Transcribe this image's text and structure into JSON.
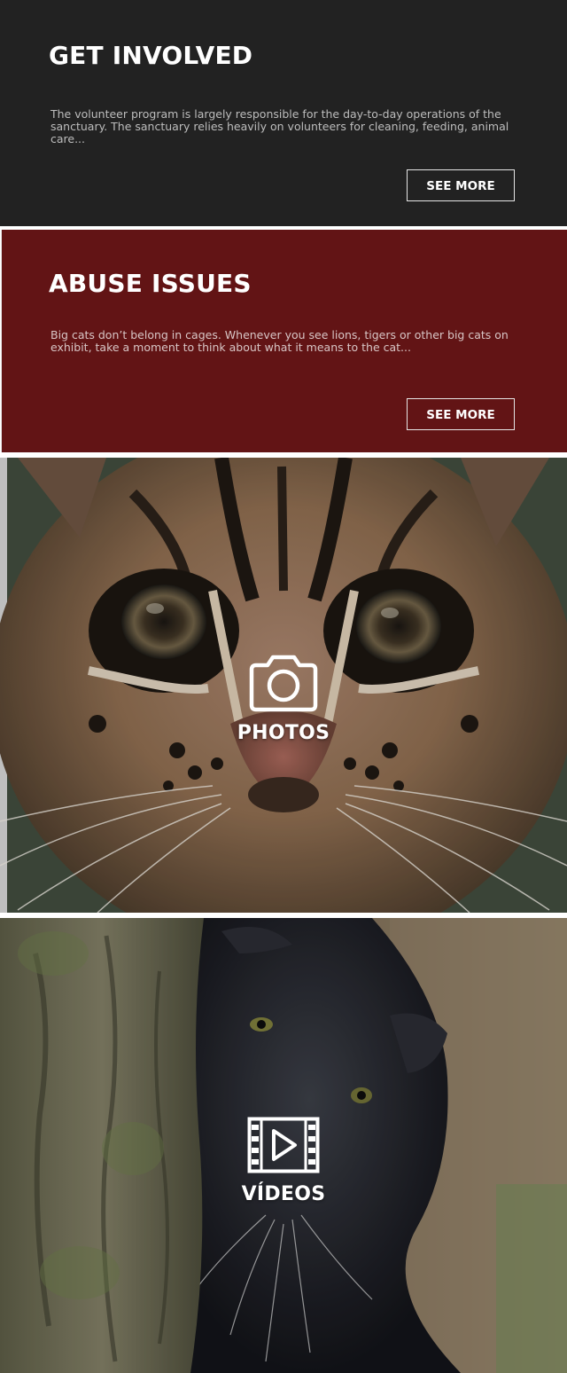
{
  "get_involved": {
    "title": "GET INVOLVED",
    "body": "The volunteer program is largely responsible for the day-to-day operations of the sanctuary. The sanctuary relies heavily on volunteers for cleaning, feeding, animal care...",
    "button_label": "SEE MORE"
  },
  "abuse_issues": {
    "title": "ABUSE ISSUES",
    "body": "Big cats don’t belong in cages.  Whenever you see lions, tigers or other big cats on exhibit, take a moment to think about what it means to the cat...",
    "button_label": "SEE MORE"
  },
  "photos": {
    "label": "PHOTOS",
    "icon": "camera-icon"
  },
  "videos": {
    "label": "VÍDEOS",
    "icon": "film-play-icon"
  },
  "colors": {
    "dark_panel": "#222222",
    "red_panel": "#621415",
    "white": "#ffffff"
  }
}
